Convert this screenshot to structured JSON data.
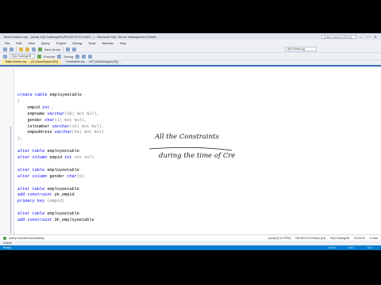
{
  "window": {
    "title": "TableCreation.sql - (local).SQLTrainingDB (REVATHI-PC\\\\VAS...) - Microsoft SQL Server Management Studio",
    "quick_launch_placeholder": "Quick Launch (Ctrl+Q)",
    "min": "—",
    "max": "□",
    "close": "✕"
  },
  "menu": [
    "File",
    "Edit",
    "View",
    "Query",
    "Project",
    "Debug",
    "Tools",
    "Window",
    "Help"
  ],
  "toolbar": {
    "new_query": "New Query",
    "database": "SQLTrainingDB",
    "execute": "Execute",
    "debug": "Debug",
    "object_box": "dbo.PrimeLog"
  },
  "tabs": [
    {
      "label": "TableCreation.sql - ...(2) (VasuMuppal (62))",
      "active": true
    },
    {
      "label": "Constraints.sql - ...NET (VasuMuppal (55))",
      "active": false
    }
  ],
  "code": [
    {
      "parts": [
        {
          "t": "create table ",
          "c": "kw"
        },
        {
          "t": "employeetable",
          "c": ""
        }
      ]
    },
    {
      "parts": [
        {
          "t": "(",
          "c": "gr"
        }
      ]
    },
    {
      "parts": [
        {
          "t": "    empid ",
          "c": ""
        },
        {
          "t": "int",
          "c": "ty"
        },
        {
          "t": " ,",
          "c": "gr"
        }
      ]
    },
    {
      "parts": [
        {
          "t": "    empname ",
          "c": ""
        },
        {
          "t": "varchar",
          "c": "ty"
        },
        {
          "t": "(30) ",
          "c": "gr"
        },
        {
          "t": "Not Null,",
          "c": "gr"
        }
      ]
    },
    {
      "parts": [
        {
          "t": "    gender ",
          "c": ""
        },
        {
          "t": "char",
          "c": "ty"
        },
        {
          "t": "(1) ",
          "c": "gr"
        },
        {
          "t": "Not Null,",
          "c": "gr"
        }
      ]
    },
    {
      "parts": [
        {
          "t": "    telnumber ",
          "c": ""
        },
        {
          "t": "varchar",
          "c": "ty"
        },
        {
          "t": "(15) ",
          "c": "gr"
        },
        {
          "t": "Not Null,",
          "c": "gr"
        }
      ]
    },
    {
      "parts": [
        {
          "t": "    empaddress ",
          "c": ""
        },
        {
          "t": "varchar",
          "c": "ty"
        },
        {
          "t": "(40) ",
          "c": "gr"
        },
        {
          "t": "Not Null",
          "c": "gr"
        }
      ]
    },
    {
      "parts": [
        {
          "t": ");",
          "c": "gr"
        }
      ]
    },
    {
      "parts": [
        {
          "t": "",
          "c": ""
        }
      ]
    },
    {
      "parts": [
        {
          "t": "alter table ",
          "c": "kw"
        },
        {
          "t": "employeetable",
          "c": ""
        }
      ]
    },
    {
      "parts": [
        {
          "t": "alter column ",
          "c": "kw"
        },
        {
          "t": "empid ",
          "c": ""
        },
        {
          "t": "int ",
          "c": "ty"
        },
        {
          "t": "not null",
          "c": "gr"
        }
      ]
    },
    {
      "parts": [
        {
          "t": "",
          "c": ""
        }
      ]
    },
    {
      "parts": [
        {
          "t": "alter table ",
          "c": "kw"
        },
        {
          "t": "employeetable",
          "c": ""
        }
      ]
    },
    {
      "parts": [
        {
          "t": "alter column ",
          "c": "kw"
        },
        {
          "t": "gender ",
          "c": ""
        },
        {
          "t": "char",
          "c": "ty"
        },
        {
          "t": "(6)",
          "c": "gr"
        }
      ]
    },
    {
      "parts": [
        {
          "t": "",
          "c": ""
        }
      ]
    },
    {
      "parts": [
        {
          "t": "alter table ",
          "c": "kw"
        },
        {
          "t": "employeetable",
          "c": ""
        }
      ]
    },
    {
      "parts": [
        {
          "t": "add constraint ",
          "c": "kw"
        },
        {
          "t": "pk_empid",
          "c": ""
        }
      ]
    },
    {
      "parts": [
        {
          "t": "primary key ",
          "c": "kw"
        },
        {
          "t": "(empid)",
          "c": "gr"
        }
      ]
    },
    {
      "parts": [
        {
          "t": "",
          "c": ""
        }
      ]
    },
    {
      "parts": [
        {
          "t": "alter table ",
          "c": "kw"
        },
        {
          "t": "employeetable",
          "c": ""
        }
      ]
    },
    {
      "parts": [
        {
          "t": "add constraint ",
          "c": "kw"
        },
        {
          "t": "DF_employeetable",
          "c": ""
        }
      ]
    }
  ],
  "annotations": {
    "line1": "All the Constraints",
    "line2": "during the time of Cre"
  },
  "status": {
    "message": "Query executed successfully.",
    "server": "(local) (13.0 RTM)",
    "login": "REVATHI-PC\\\\Vasu (54)",
    "database": "SQLTrainingDB",
    "time": "00:00:00",
    "rows": "0 rows"
  },
  "output_label": "Output",
  "bottom": {
    "left": "Ready",
    "ln": "Ln 40",
    "col": "Col 2",
    "ch": "Ch 2"
  }
}
